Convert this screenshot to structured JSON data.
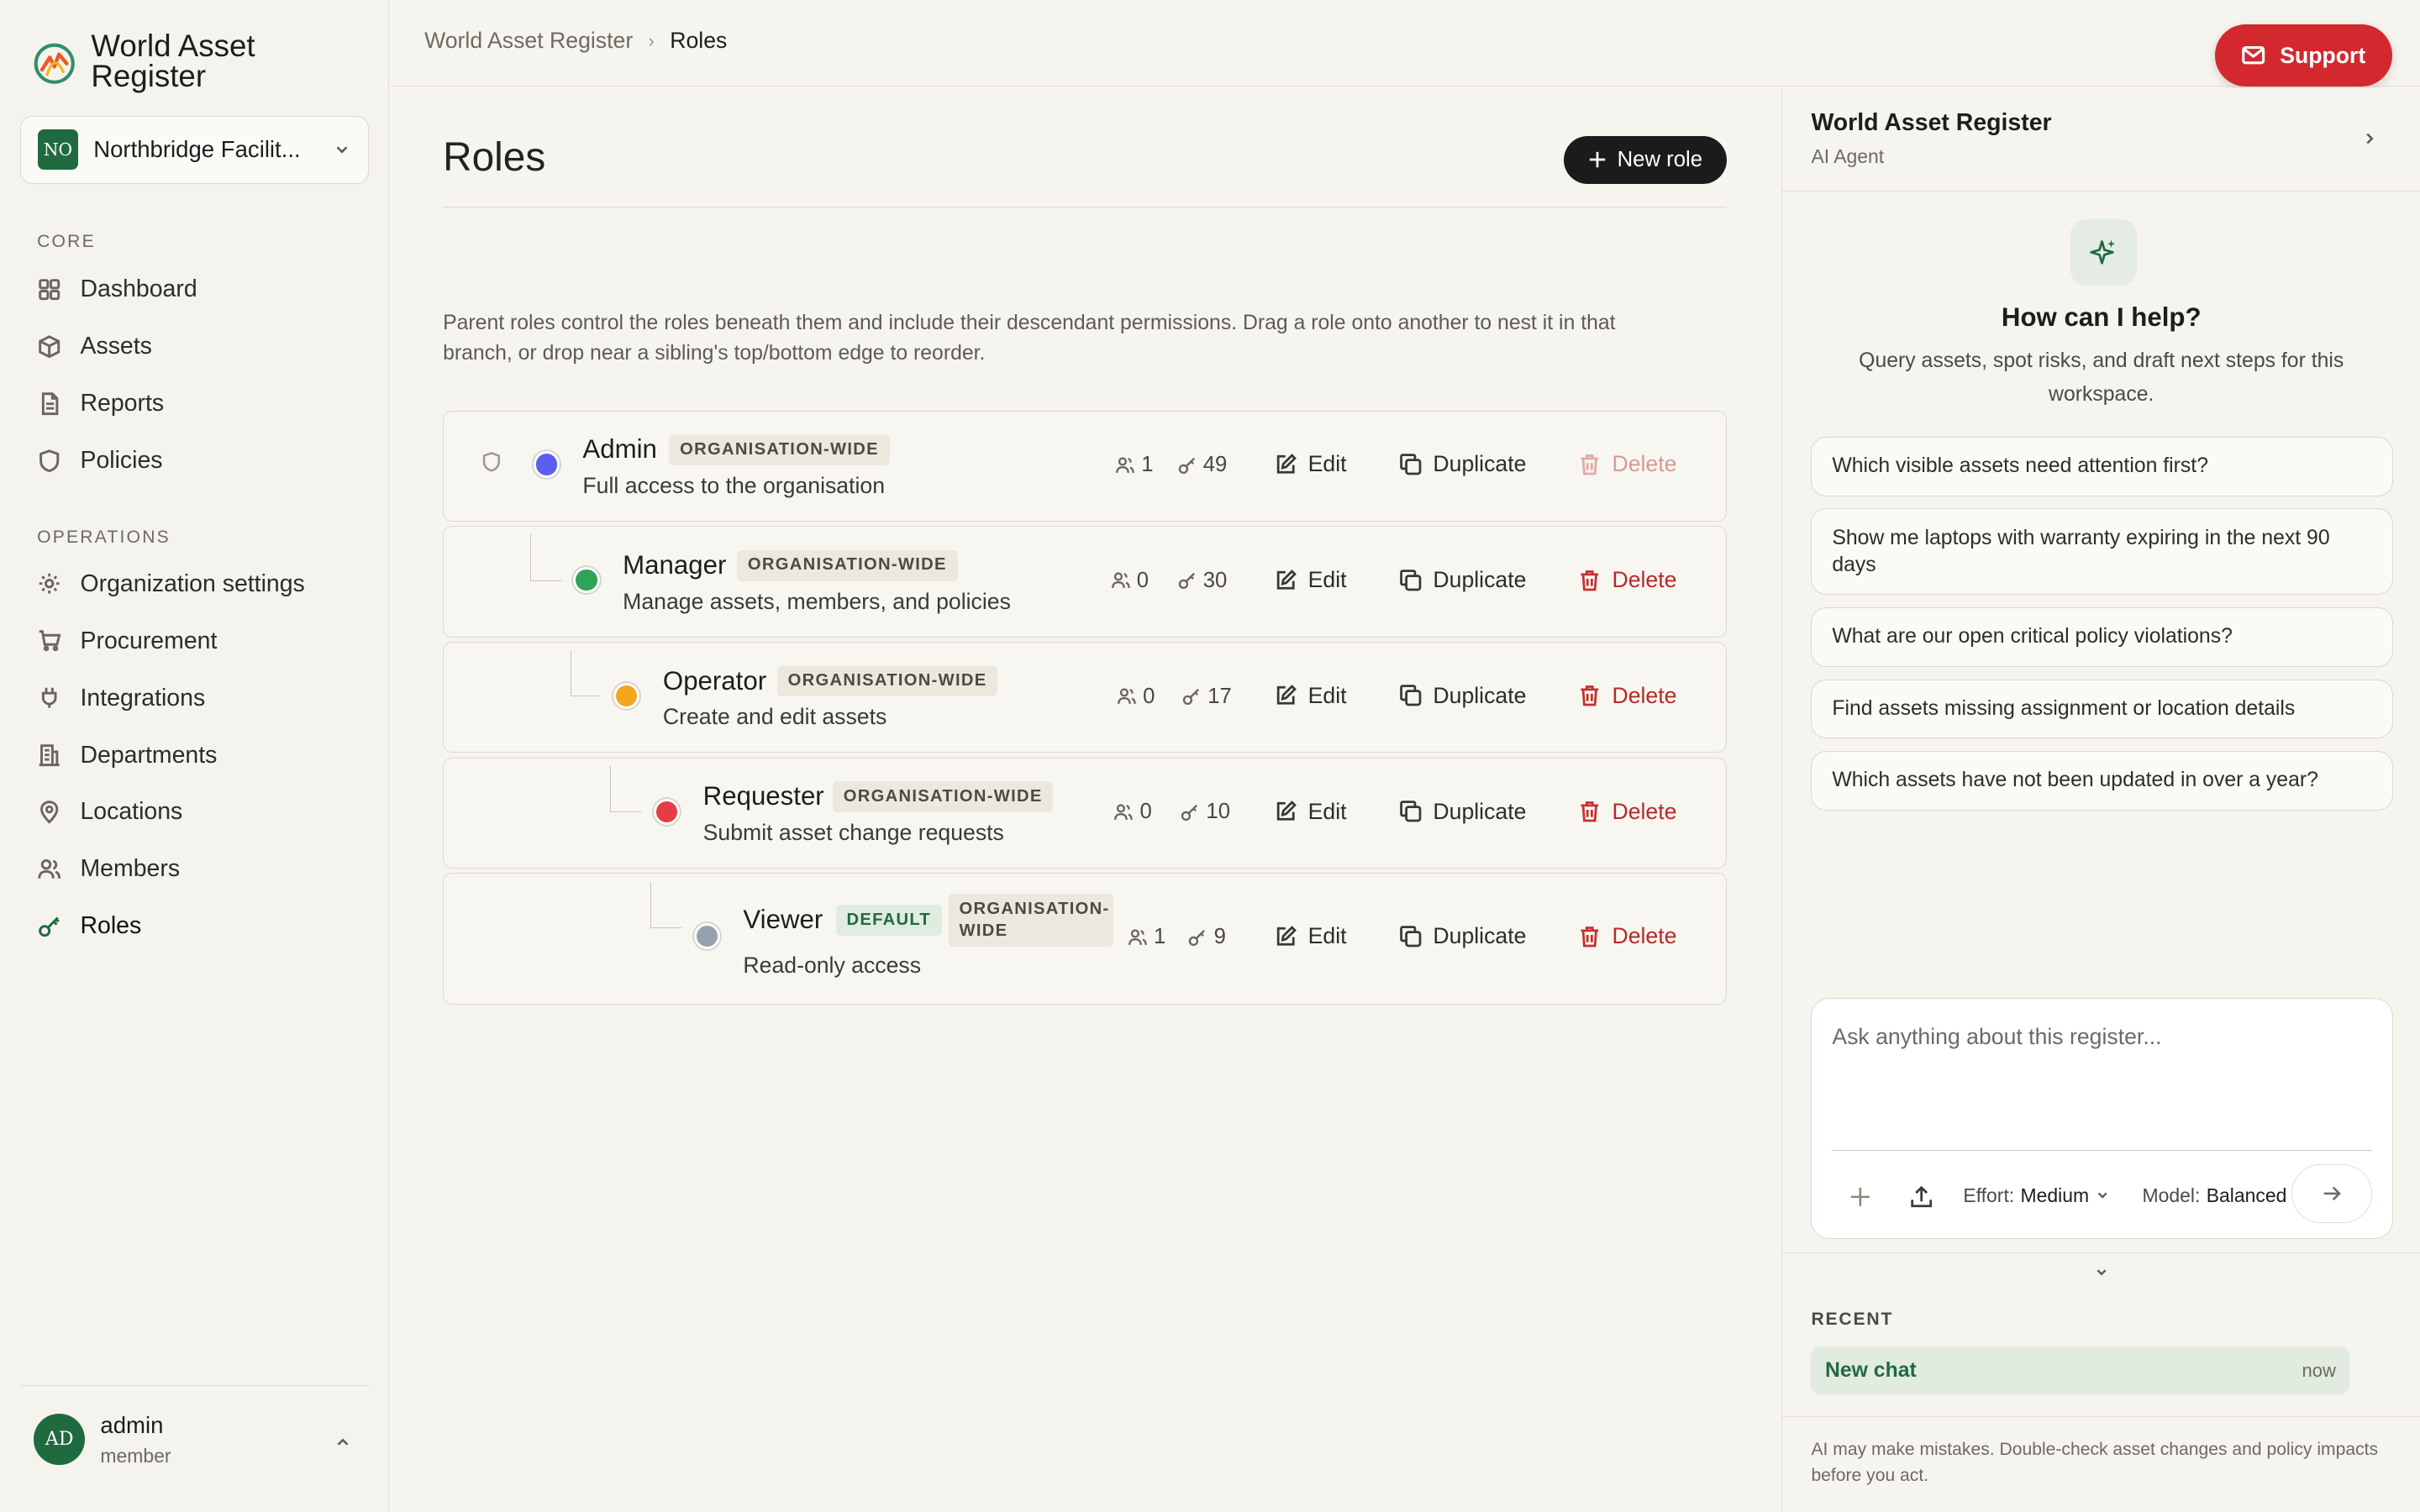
{
  "app": {
    "brand": "World Asset Register"
  },
  "sidebar": {
    "org": {
      "badge": "NO",
      "name": "Northbridge Facilit..."
    },
    "sections": {
      "core": "CORE",
      "operations": "OPERATIONS"
    },
    "core_items": [
      {
        "label": "Dashboard",
        "icon": "grid-icon"
      },
      {
        "label": "Assets",
        "icon": "box-icon"
      },
      {
        "label": "Reports",
        "icon": "file-icon"
      },
      {
        "label": "Policies",
        "icon": "shield-icon"
      }
    ],
    "ops_items": [
      {
        "label": "Organization settings",
        "icon": "gear-icon"
      },
      {
        "label": "Procurement",
        "icon": "cart-icon"
      },
      {
        "label": "Integrations",
        "icon": "plug-icon"
      },
      {
        "label": "Departments",
        "icon": "building-icon"
      },
      {
        "label": "Locations",
        "icon": "pin-icon"
      },
      {
        "label": "Members",
        "icon": "users-icon"
      },
      {
        "label": "Roles",
        "icon": "key-icon",
        "active": true
      }
    ],
    "user": {
      "initials": "AD",
      "name": "admin",
      "role": "member"
    }
  },
  "topbar": {
    "breadcrumb": [
      "World Asset Register",
      "Roles"
    ],
    "support_label": "Support",
    "support_color": "#d4282f"
  },
  "main": {
    "title": "Roles",
    "new_role_label": "New role",
    "help_text": "Parent roles control the roles beneath them and include their descendant permissions. Drag a role onto another to nest it in that branch, or drop near a sibling's top/bottom edge to reorder.",
    "actions": {
      "edit": "Edit",
      "duplicate": "Duplicate",
      "delete": "Delete"
    },
    "roles": [
      {
        "name": "Admin",
        "tag": "ORGANISATION-WIDE",
        "desc": "Full access to the organisation",
        "members": "1",
        "perms": "49",
        "color": "#5b5ef0",
        "depth": 0
      },
      {
        "name": "Manager",
        "tag": "ORGANISATION-WIDE",
        "desc": "Manage assets, members, and policies",
        "members": "0",
        "perms": "30",
        "color": "#2fa35a",
        "depth": 1
      },
      {
        "name": "Operator",
        "tag": "ORGANISATION-WIDE",
        "desc": "Create and edit assets",
        "members": "0",
        "perms": "17",
        "color": "#f4a61d",
        "depth": 2
      },
      {
        "name": "Requester",
        "tag": "ORGANISATION-WIDE",
        "desc": "Submit asset change requests",
        "members": "0",
        "perms": "10",
        "color": "#e53c45",
        "depth": 3
      },
      {
        "name": "Viewer",
        "default_tag": "DEFAULT",
        "tag_line1": "ORGANISATION-",
        "tag_line2": "WIDE",
        "desc": "Read-only access",
        "members": "1",
        "perms": "9",
        "color": "#95a1ad",
        "depth": 4
      }
    ]
  },
  "panel": {
    "title": "World Asset Register",
    "subtitle": "AI Agent",
    "help_title": "How can I help?",
    "help_sub": "Query assets, spot risks, and draft next steps for this workspace.",
    "suggestions": [
      "Which visible assets need attention first?",
      "Show me laptops with warranty expiring in the next 90 days",
      "What are our open critical policy violations?",
      "Find assets missing assignment or location details",
      "Which assets have not been updated in over a year?"
    ],
    "composer_placeholder": "Ask anything about this register...",
    "effort_label": "Effort:",
    "effort_value": "Medium",
    "model_label": "Model:",
    "model_value": "Balanced",
    "recent_label": "RECENT",
    "recent_items": [
      {
        "title": "New chat",
        "time": "now"
      }
    ],
    "disclaimer": "AI may make mistakes. Double-check asset changes and policy impacts before you act."
  }
}
